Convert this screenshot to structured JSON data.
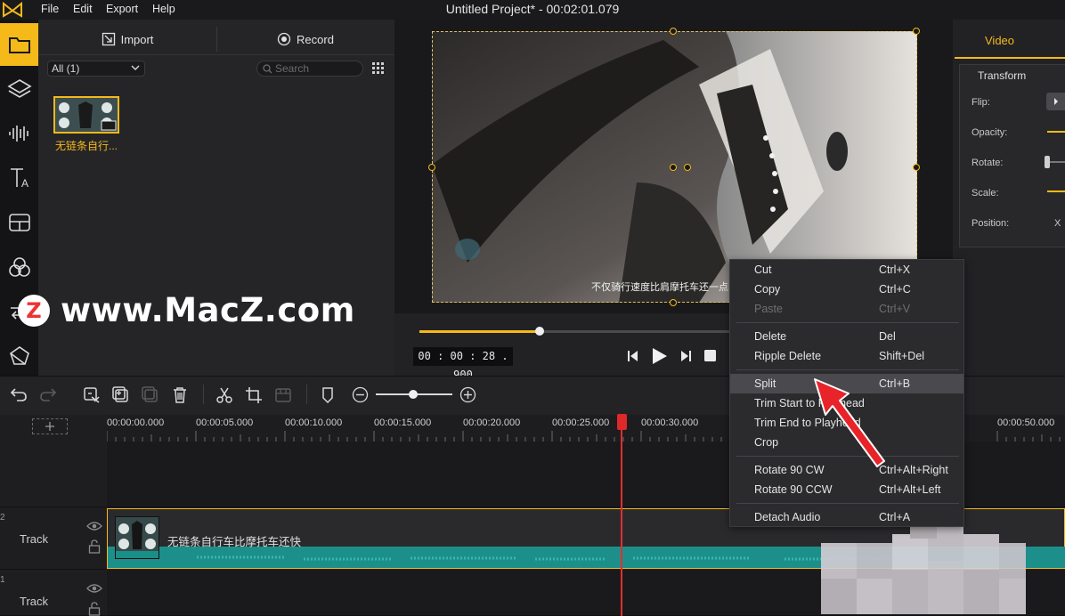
{
  "menubar": {
    "items": [
      "File",
      "Edit",
      "Export",
      "Help"
    ],
    "title": "Untitled Project* - 00:02:01.079"
  },
  "media": {
    "import_label": "Import",
    "record_label": "Record",
    "filter": "All (1)",
    "search_placeholder": "Search",
    "item_label": "无链条自行..."
  },
  "preview": {
    "subtitle": "不仅骑行速度比肩摩托车还一点",
    "timecode": "00 : 00 : 28 . 900",
    "progress": 0.375
  },
  "properties": {
    "tab": "Video",
    "section": "Transform",
    "labels": [
      "Flip:",
      "Opacity:",
      "Rotate:",
      "Scale:",
      "Position:"
    ],
    "position_x": "X"
  },
  "timeline": {
    "ticks": [
      "00:00:00.000",
      "00:00:05.000",
      "00:00:10.000",
      "00:00:15.000",
      "00:00:20.000",
      "00:00:25.000",
      "00:00:30.000",
      "00:00:50.000"
    ],
    "tracks": [
      {
        "num": "2",
        "label": "Track"
      },
      {
        "num": "1",
        "label": "Track"
      }
    ],
    "clip_name": "无链条自行车比摩托车还快"
  },
  "context_menu": {
    "items": [
      {
        "label": "Cut",
        "key": "Ctrl+X"
      },
      {
        "label": "Copy",
        "key": "Ctrl+C"
      },
      {
        "label": "Paste",
        "key": "Ctrl+V",
        "disabled": true
      },
      {
        "label": "Delete",
        "key": "Del"
      },
      {
        "label": "Ripple Delete",
        "key": "Shift+Del"
      },
      {
        "label": "Split",
        "key": "Ctrl+B",
        "highlighted": true
      },
      {
        "label": "Trim Start to Playhead",
        "key": ""
      },
      {
        "label": "Trim End to Playhead",
        "key": ""
      },
      {
        "label": "Crop",
        "key": ""
      },
      {
        "label": "Rotate 90 CW",
        "key": "Ctrl+Alt+Right"
      },
      {
        "label": "Rotate 90 CCW",
        "key": "Ctrl+Alt+Left"
      },
      {
        "label": "Detach Audio",
        "key": "Ctrl+A"
      }
    ]
  },
  "watermark": {
    "text": "www.MacZ.com",
    "badge": "Z"
  },
  "colors": {
    "accent": "#f5b91a",
    "playhead": "#e32e2e",
    "waveform": "#1d8f8a"
  }
}
